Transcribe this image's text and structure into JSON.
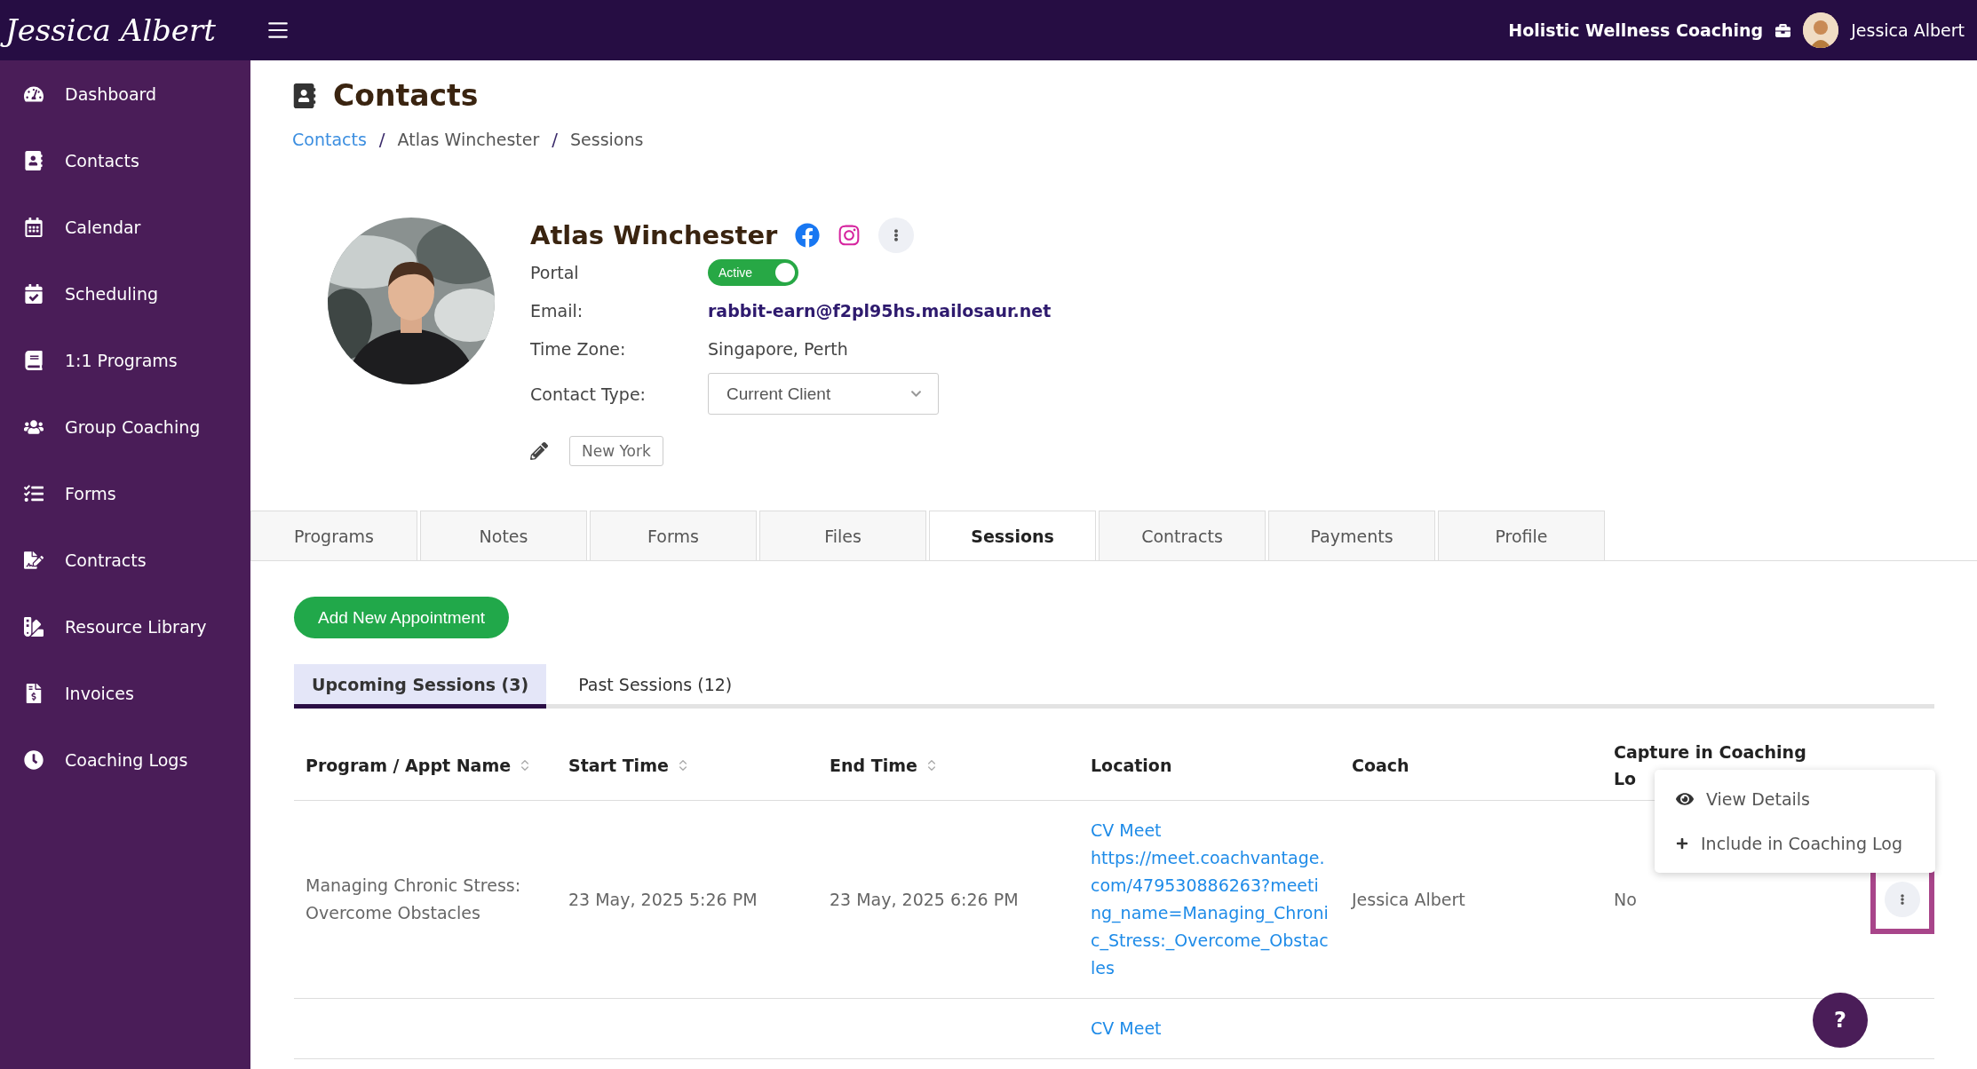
{
  "header": {
    "logo": "Jessica Albert",
    "business": "Holistic Wellness Coaching",
    "user": "Jessica Albert"
  },
  "sidebar": {
    "items": [
      {
        "label": "Dashboard"
      },
      {
        "label": "Contacts"
      },
      {
        "label": "Calendar"
      },
      {
        "label": "Scheduling"
      },
      {
        "label": "1:1 Programs"
      },
      {
        "label": "Group Coaching"
      },
      {
        "label": "Forms"
      },
      {
        "label": "Contracts"
      },
      {
        "label": "Resource Library"
      },
      {
        "label": "Invoices"
      },
      {
        "label": "Coaching Logs"
      }
    ]
  },
  "page": {
    "title": "Contacts",
    "separator": "/",
    "breadcrumb": [
      {
        "label": "Contacts",
        "kind": "link"
      },
      {
        "label": "Atlas Winchester",
        "kind": "text"
      },
      {
        "label": "Sessions",
        "kind": "text"
      }
    ]
  },
  "contact": {
    "name": "Atlas Winchester",
    "portal": {
      "label": "Portal",
      "status": "Active",
      "on": true
    },
    "fields": [
      {
        "label": "Email:",
        "value": "rabbit-earn@f2pl95hs.mailosaur.net",
        "kind": "email"
      },
      {
        "label": "Time Zone:",
        "value": "Singapore, Perth",
        "kind": "text"
      }
    ],
    "contact_type": {
      "label": "Contact Type:",
      "value": "Current Client"
    },
    "location_tag": "New York"
  },
  "tabs": [
    {
      "label": "Programs",
      "selected": false
    },
    {
      "label": "Notes",
      "selected": false
    },
    {
      "label": "Forms",
      "selected": false
    },
    {
      "label": "Files",
      "selected": false
    },
    {
      "label": "Sessions",
      "selected": true
    },
    {
      "label": "Contracts",
      "selected": false
    },
    {
      "label": "Payments",
      "selected": false
    },
    {
      "label": "Profile",
      "selected": false
    }
  ],
  "add_button": "Add New Appointment",
  "session_tabs": [
    {
      "label": "Upcoming Sessions (3)",
      "selected": true
    },
    {
      "label": "Past Sessions (12)",
      "selected": false
    }
  ],
  "table": {
    "columns": [
      {
        "label": "Program / Appt Name",
        "sortable": true
      },
      {
        "label": "Start Time",
        "sortable": true
      },
      {
        "label": "End Time",
        "sortable": true
      },
      {
        "label": "Location",
        "sortable": false
      },
      {
        "label": "Coach",
        "sortable": false
      },
      {
        "label": "Capture in Coaching Lo",
        "sortable": false
      }
    ],
    "rows": [
      {
        "program": "Managing Chronic Stress: Overcome Obstacles",
        "start": "23 May, 2025 5:26 PM",
        "end": "23 May, 2025 6:26 PM",
        "location_title": "CV Meet",
        "location_url": "https://meet.coachvantage.com/479530886263?meeting_name=Managing_Chronic_Stress:_Overcome_Obstacles",
        "coach": "Jessica Albert",
        "capture": "No",
        "action_highlighted": true
      },
      {
        "location_title": "CV Meet"
      }
    ]
  },
  "row_menu": {
    "items": [
      {
        "label": "View Details",
        "kind": "view"
      },
      {
        "label": "Include in Coaching Log",
        "kind": "add"
      }
    ]
  },
  "help": "?"
}
